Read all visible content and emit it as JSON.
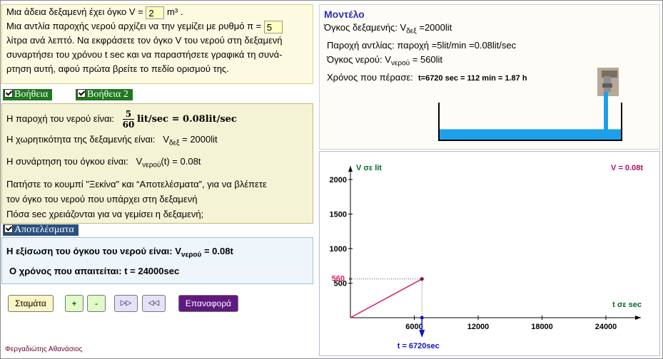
{
  "problem": {
    "l1a": "Μια άδεια δεξαμενή έχει όγκο V =",
    "volume_value": "2",
    "l1b": "m³ .",
    "l2a": "Μια αντλία παροχής νερού αρχίζει να την γεμίζει με ρυθμό π =",
    "rate_value": "5",
    "l3": "λίτρα ανά λεπτό. Να εκφράσετε τον όγκο V του  νερού στη δεξαμενή",
    "l4": "συναρτήσει του χρόνου t sec και να παραστήσετε γραφικά τη συνά-",
    "l5": "ρτηση αυτή, αφού πρώτα βρείτε το πεδίο ορισμού της."
  },
  "checkboxes": {
    "help1": "Βοήθεια",
    "help2": "Βοήθεια 2",
    "results": "Αποτελέσματα"
  },
  "help": {
    "flow_label": "Η παροχή του νερού είναι:",
    "flow_num": "5",
    "flow_den": "60",
    "flow_rest": "lit/sec = 0.08lit/sec",
    "capacity_label": "Η χωρητικότητα της δεξαμενής είναι:",
    "capacity_v": "V",
    "capacity_sub": "δεξ",
    "capacity_val": "= 2000lit",
    "function_label": "Η συνάρτηση του όγκου είναι:",
    "function_v": "V",
    "function_sub": "νερού",
    "function_val": "(t) = 0.08t",
    "p1": "Πατήστε  το κουμπί  \"Ξεκίνα\"   και “Αποτελέσματα”, για να βλέπετε",
    "p2": "τον όγκο του νερού που υπάρχει στη δεξαμενή",
    "p3": "Πόσα sec χρειάζονται για να γεμίσει η δεξαμενή;"
  },
  "results": {
    "eq_label": "Η εξίσωση του όγκου του νερού είναι: V",
    "eq_sub": "νερού",
    "eq_val": "= 0.08t",
    "time_label": "Ο χρόνος που απαιτείται:  t = 24000sec"
  },
  "buttons": {
    "stop": "Σταμάτα",
    "plus": "+",
    "minus": "-",
    "forward": "▷▷",
    "rewind": "◁◁",
    "reset": "Επαναφορά"
  },
  "author": "Φεργαδιώτης Αθανάσιος",
  "model": {
    "title": "Μοντέλο",
    "tank_label": "Όγκος δεξαμενής: V",
    "tank_sub": "δεξ",
    "tank_val": "=2000lit",
    "pump_label": "Παροχή αντλίας: παροχή =5lit/min =0.08lit/sec",
    "water_label": "Όγκος νερού: V",
    "water_sub": "νερού",
    "water_val": "= 560lit",
    "time_label": "Χρόνος που πέρασε:",
    "time_val": "t=6720 sec = 112 min = 1.87 h",
    "water_level_fraction": 0.28
  },
  "colors": {
    "checkbox_green": "#1f7a1f",
    "results_blue": "#2a4f7d",
    "reset_purple": "#5e1a80",
    "water": "#1ea0e8",
    "line": "#e0205a",
    "axis_label_green": "#0a6b2a",
    "formula_pink": "#b01065",
    "time_marker": "#1010d0"
  },
  "chart_data": {
    "type": "line",
    "xlabel": "t σε sec",
    "ylabel": "V σε lit",
    "formula": "V = 0.08t",
    "x_ticks": [
      "6000",
      "12000",
      "18000",
      "24000"
    ],
    "y_ticks": [
      "500",
      "1000",
      "1500",
      "2000"
    ],
    "xlim": [
      0,
      26000
    ],
    "ylim": [
      0,
      2200
    ],
    "series": [
      {
        "x": [
          0,
          6720
        ],
        "y": [
          0,
          560
        ]
      }
    ],
    "current_t_label": "t = 6720sec",
    "current_v_label": "560",
    "current_t": 6720,
    "current_v": 560
  }
}
